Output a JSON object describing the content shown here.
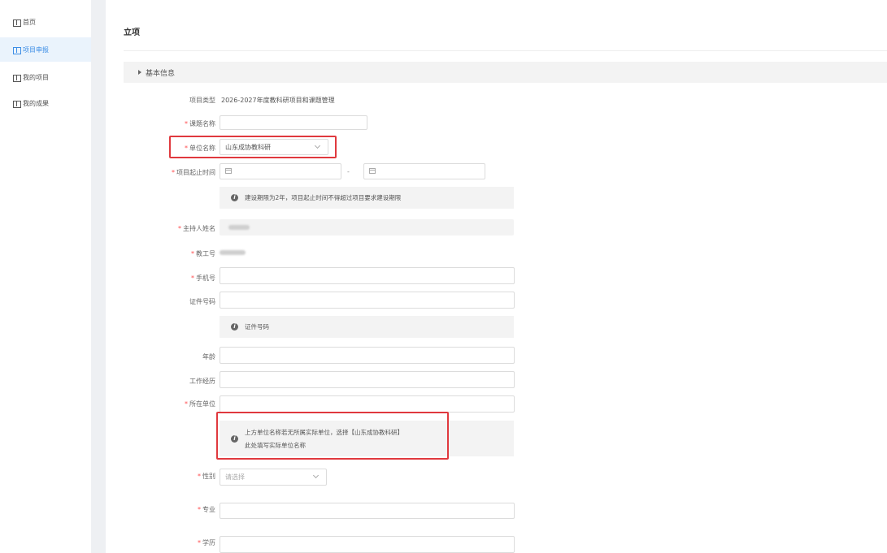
{
  "sidebar": {
    "items": [
      {
        "label": "首页",
        "icon": "grid-icon"
      },
      {
        "label": "项目申报",
        "icon": "grid-icon",
        "active": true
      },
      {
        "label": "我的项目",
        "icon": "grid-icon"
      },
      {
        "label": "我的成果",
        "icon": "grid-icon"
      }
    ]
  },
  "page": {
    "title": "立项",
    "section": "基本信息"
  },
  "form": {
    "project_type_label": "项目类型",
    "project_type_value": "2026-2027年度教科研项目和课题管理",
    "topic_label": "课题名称",
    "unit_label": "单位名称",
    "unit_value": "山东成协教科研",
    "period_label": "项目起止时间",
    "period_sep": "-",
    "period_notice": "建设期限为2年，项目起止时间不得超过项目要求建设期限",
    "host_label": "主持人姓名",
    "staff_id_label": "教工号",
    "phone_label": "手机号",
    "id_label": "证件号码",
    "id_notice": "证件号码",
    "age_label": "年龄",
    "work_label": "工作经历",
    "org_label": "所在单位",
    "org_notice_line1": "上方单位名称若无所属实际单位，选择【山东成协教科研】",
    "org_notice_line2": "此处填写实际单位名称",
    "gender_label": "性别",
    "gender_placeholder": "请选择",
    "major_label": "专业",
    "edu_label": "学历",
    "required_mark": "*"
  },
  "colors": {
    "accent": "#3d8ee6",
    "highlight": "#e0393e",
    "required": "#ff4d4f"
  }
}
